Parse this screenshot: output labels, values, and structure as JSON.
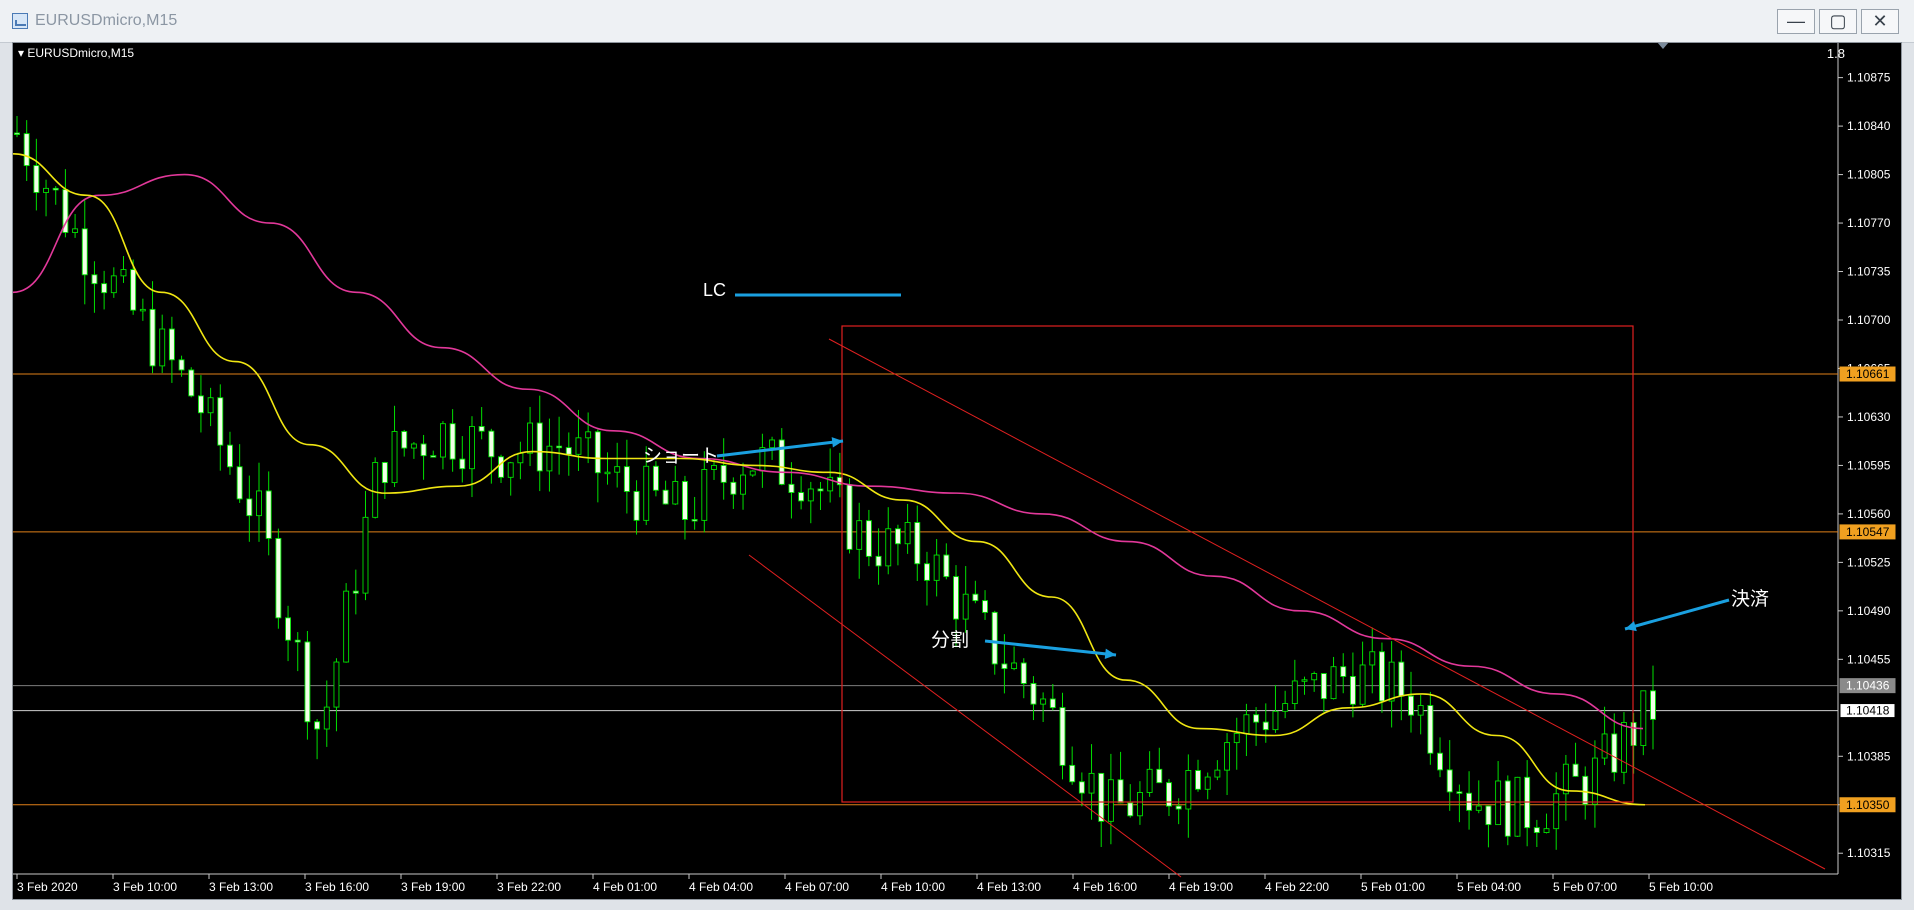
{
  "window": {
    "title": "EURUSDmicro,M15",
    "ratio": "1.8"
  },
  "controls": {
    "minimize": "—",
    "maximize": "▢",
    "close": "✕"
  },
  "colors": {
    "bull": "#00e000",
    "bear_body": "#f2ffe8",
    "ema_fast": "#f0e612",
    "ema_slow": "#e2389a",
    "level_line": "#e07f18",
    "annotation_arrow": "#1aa0e0",
    "channel": "#e02020"
  },
  "axis": {
    "y_ticks": [
      "1.10875",
      "1.10840",
      "1.10805",
      "1.10770",
      "1.10735",
      "1.10700",
      "1.10665",
      "1.10630",
      "1.10595",
      "1.10560",
      "1.10525",
      "1.10490",
      "1.10455",
      "1.10385",
      "1.10350",
      "1.10315"
    ],
    "x_ticks": [
      "3 Feb 2020",
      "3 Feb 10:00",
      "3 Feb 13:00",
      "3 Feb 16:00",
      "3 Feb 19:00",
      "3 Feb 22:00",
      "4 Feb 01:00",
      "4 Feb 04:00",
      "4 Feb 07:00",
      "4 Feb 10:00",
      "4 Feb 13:00",
      "4 Feb 16:00",
      "4 Feb 19:00",
      "4 Feb 22:00",
      "5 Feb 01:00",
      "5 Feb 04:00",
      "5 Feb 07:00",
      "5 Feb 10:00"
    ]
  },
  "price_tags": [
    {
      "text": "1.10661",
      "style": "orange",
      "price": 1.10661
    },
    {
      "text": "1.10547",
      "style": "orange",
      "price": 1.10547
    },
    {
      "text": "1.10436",
      "style": "gray",
      "price": 1.10436
    },
    {
      "text": "1.10418",
      "style": "white",
      "price": 1.10418
    },
    {
      "text": "1.10350",
      "style": "orange",
      "price": 1.1035
    }
  ],
  "annotations": {
    "lc": "LC",
    "short": "ショート",
    "split": "分割",
    "close": "決済"
  },
  "chart_data": {
    "type": "candlestick",
    "symbol": "EURUSDmicro",
    "timeframe": "M15",
    "ylim": [
      1.103,
      1.109
    ],
    "x": [
      "3 Feb 2020",
      "3 Feb 10:00",
      "3 Feb 13:00",
      "3 Feb 16:00",
      "3 Feb 19:00",
      "3 Feb 22:00",
      "4 Feb 01:00",
      "4 Feb 04:00",
      "4 Feb 07:00",
      "4 Feb 10:00",
      "4 Feb 13:00",
      "4 Feb 16:00",
      "4 Feb 19:00",
      "4 Feb 22:00",
      "5 Feb 01:00",
      "5 Feb 04:00",
      "5 Feb 07:00",
      "5 Feb 10:00"
    ],
    "price_path": [
      1.10835,
      1.1076,
      1.107,
      1.1064,
      1.10555,
      1.104,
      1.106,
      1.1062,
      1.10605,
      1.1061,
      1.1058,
      1.1056,
      1.106,
      1.1059,
      1.1054,
      1.1053,
      1.1047,
      1.1042,
      1.10345,
      1.1036,
      1.104,
      1.10425,
      1.10445,
      1.1043,
      1.10355,
      1.10345,
      1.1037,
      1.1042
    ],
    "series": [
      {
        "name": "EMA fast",
        "values": [
          1.1082,
          1.1079,
          1.1072,
          1.1067,
          1.1061,
          1.10575,
          1.1058,
          1.10605,
          1.106,
          1.106,
          1.10595,
          1.1059,
          1.1057,
          1.1054,
          1.105,
          1.1044,
          1.10405,
          1.104,
          1.1042,
          1.1043,
          1.104,
          1.1036,
          1.1035
        ]
      },
      {
        "name": "EMA slow",
        "values": [
          1.1072,
          1.1079,
          1.10805,
          1.1077,
          1.1072,
          1.1068,
          1.1065,
          1.1062,
          1.106,
          1.1059,
          1.1058,
          1.10575,
          1.1056,
          1.1054,
          1.10515,
          1.1049,
          1.1047,
          1.1045,
          1.1043,
          1.10405
        ]
      }
    ]
  }
}
